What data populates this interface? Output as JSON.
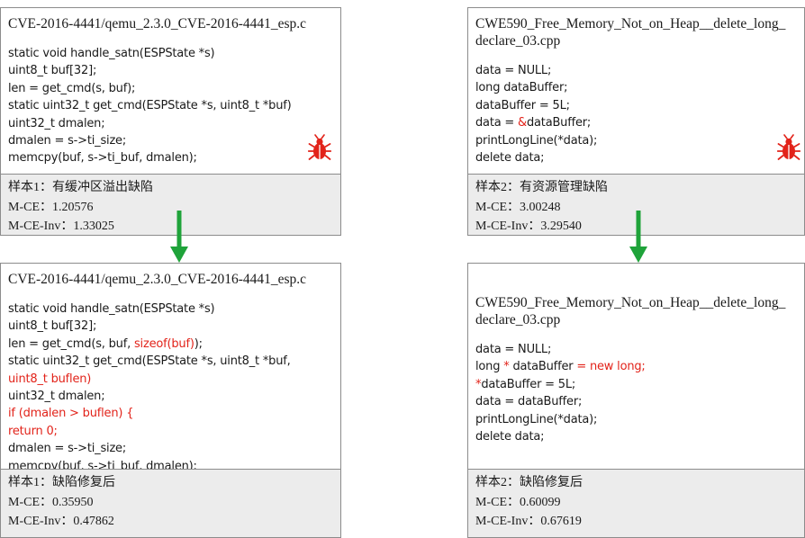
{
  "panels": [
    {
      "id": "p1",
      "title": "CVE-2016-4441/qemu_2.3.0_CVE-2016-4441_esp.c",
      "lines": [
        [
          {
            "t": "static void handle_satn(ESPState *s)"
          }
        ],
        [
          {
            "t": "uint8_t buf[32];"
          }
        ],
        [
          {
            "t": "len = get_cmd(s, buf);"
          }
        ],
        [
          {
            "t": "static uint32_t get_cmd(ESPState *s, uint8_t *buf)"
          }
        ],
        [
          {
            "t": "uint32_t dmalen;"
          }
        ],
        [
          {
            "t": "dmalen = s->ti_size;"
          }
        ],
        [
          {
            "t": "memcpy(buf, s->ti_buf, dmalen);"
          }
        ]
      ],
      "footer": [
        "样本1：有缓冲区溢出缺陷",
        "M-CE：1.20576",
        "M-CE-Inv：1.33025"
      ],
      "bug": true
    },
    {
      "id": "p2",
      "title": "CWE590_Free_Memory_Not_on_Heap__delete_long_\ndeclare_03.cpp",
      "lines": [
        [
          {
            "t": "data = NULL;"
          }
        ],
        [
          {
            "t": "long dataBuffer;"
          }
        ],
        [
          {
            "t": "dataBuffer = 5L;"
          }
        ],
        [
          {
            "t": "data = "
          },
          {
            "t": "&",
            "red": true
          },
          {
            "t": "dataBuffer;"
          }
        ],
        [
          {
            "t": "printLongLine(*data);"
          }
        ],
        [
          {
            "t": "delete data;"
          }
        ]
      ],
      "footer": [
        "样本2：有资源管理缺陷",
        "M-CE：3.00248",
        "M-CE-Inv：3.29540"
      ],
      "bug": true
    },
    {
      "id": "p3",
      "title": "CVE-2016-4441/qemu_2.3.0_CVE-2016-4441_esp.c",
      "lines": [
        [
          {
            "t": "static void handle_satn(ESPState *s)"
          }
        ],
        [
          {
            "t": "uint8_t buf[32];"
          }
        ],
        [
          {
            "t": "len = get_cmd(s, buf, "
          },
          {
            "t": "sizeof(buf)",
            "red": true
          },
          {
            "t": ");"
          }
        ],
        [
          {
            "t": "static uint32_t get_cmd(ESPState *s, uint8_t *buf,"
          }
        ],
        [
          {
            "t": "uint8_t buflen)",
            "red": true
          }
        ],
        [
          {
            "t": "uint32_t dmalen;"
          }
        ],
        [
          {
            "t": "if (dmalen > buflen) {",
            "red": true
          }
        ],
        [
          {
            "t": "return 0;",
            "red": true
          }
        ],
        [
          {
            "t": "dmalen = s->ti_size;"
          }
        ],
        [
          {
            "t": "memcpy(buf, s->ti_buf, dmalen);"
          }
        ]
      ],
      "footer": [
        "样本1：缺陷修复后",
        "M-CE：0.35950",
        "M-CE-Inv：0.47862"
      ],
      "bug": false
    },
    {
      "id": "p4",
      "title": "CWE590_Free_Memory_Not_on_Heap__delete_long_\ndeclare_03.cpp",
      "lines": [
        [
          {
            "t": "data = NULL;"
          }
        ],
        [
          {
            "t": "long "
          },
          {
            "t": "*",
            "red": true
          },
          {
            "t": " dataBuffer "
          },
          {
            "t": "= new long;",
            "red": true
          }
        ],
        [
          {
            "t": "*",
            "red": true
          },
          {
            "t": "dataBuffer = 5L;"
          }
        ],
        [
          {
            "t": "data = dataBuffer;"
          }
        ],
        [
          {
            "t": "printLongLine(*data);"
          }
        ],
        [
          {
            "t": "delete data;"
          }
        ]
      ],
      "footer": [
        "样本2：缺陷修复后",
        "M-CE：0.60099",
        "M-CE-Inv：0.67619"
      ],
      "bug": false
    }
  ],
  "colors": {
    "highlight": "#e2231a",
    "arrow": "#1fa33a",
    "footer_bg": "#ececec",
    "bug": "#e2231a"
  },
  "icons": {
    "bug": "bug-icon",
    "arrow": "down-arrow-icon"
  }
}
